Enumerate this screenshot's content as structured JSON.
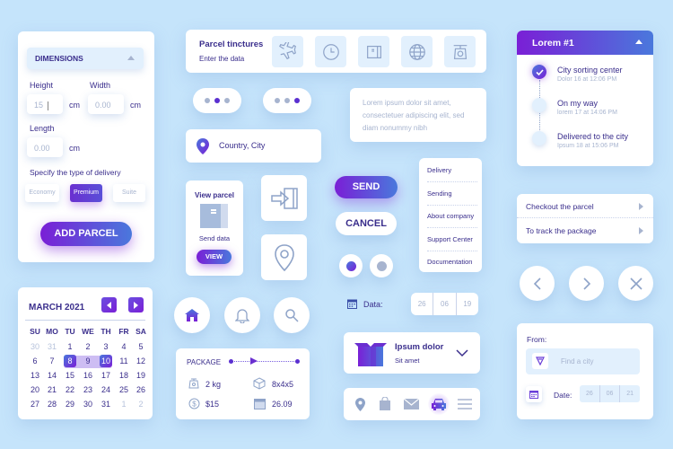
{
  "colors": {
    "background": "#c5e4fb",
    "navy": "#3a2e8c",
    "purple": "#7a1fd6",
    "blue": "#4a78dc",
    "muted": "#a7b4cf",
    "light": "#e2f0fd"
  },
  "dimensions": {
    "header": "DIMENSIONS",
    "height_label": "Height",
    "height_value": "15",
    "width_label": "Width",
    "width_placeholder": "0.00",
    "length_label": "Length",
    "length_placeholder": "0.00",
    "unit": "cm",
    "delivery_label": "Specify the type of delivery",
    "delivery_options": [
      "Economy",
      "Premium",
      "Suite"
    ],
    "delivery_selected": "Premium",
    "add_button": "ADD PARCEL"
  },
  "calendar": {
    "title": "MARCH 2021",
    "weekdays": [
      "SU",
      "MO",
      "TU",
      "WE",
      "TH",
      "FR",
      "SA"
    ],
    "weeks": [
      [
        "30",
        "31",
        "1",
        "2",
        "3",
        "4",
        "5"
      ],
      [
        "6",
        "7",
        "8",
        "9",
        "10",
        "11",
        "12"
      ],
      [
        "13",
        "14",
        "15",
        "16",
        "17",
        "18",
        "19"
      ],
      [
        "20",
        "21",
        "22",
        "23",
        "24",
        "25",
        "26"
      ],
      [
        "27",
        "28",
        "29",
        "30",
        "31",
        "1",
        "2"
      ]
    ],
    "range_start": "8",
    "range_end": "10"
  },
  "parcel_tinctures": {
    "title": "Parcel tinctures",
    "subtitle": "Enter the data",
    "icons": [
      "airplane-icon",
      "clock-icon",
      "box-icon",
      "globe-icon",
      "scale-icon"
    ]
  },
  "location": {
    "text": "Country, City"
  },
  "lorem_text": "Lorem ipsum dolor sit amet, consectetuer adipiscing elit, sed diam nonummy nibh",
  "view_parcel": {
    "title": "View parcel",
    "subtitle": "Send data",
    "button": "VIEW"
  },
  "buttons": {
    "send": "SEND",
    "cancel": "CANCEL"
  },
  "menu": {
    "items": [
      "Delivery",
      "Sending",
      "About company",
      "Support Center",
      "Documentation"
    ]
  },
  "tracking": {
    "title": "Lorem #1",
    "steps": [
      {
        "title": "City sorting center",
        "time": "Dolor 16 at 12:06 PM",
        "done": true
      },
      {
        "title": "On my way",
        "time": "lorem 17 at 14:06 PM",
        "done": false
      },
      {
        "title": "Delivered to the city",
        "time": "Ipsum 18 at 15:06 PM",
        "done": false
      }
    ]
  },
  "links": {
    "items": [
      "Checkout the parcel",
      "To track the package"
    ]
  },
  "package": {
    "title": "PACKAGE",
    "weight": "2 kg",
    "size": "8x4x5",
    "price": "$15",
    "date": "26.09"
  },
  "data_row": {
    "label": "Data:",
    "day": "26",
    "month": "06",
    "year": "19"
  },
  "dropdown": {
    "title": "Ipsum dolor",
    "subtitle": "Sit amet"
  },
  "from_card": {
    "label": "From:",
    "placeholder": "Find a city",
    "date_label": "Date:",
    "day": "26",
    "month": "06",
    "year": "21"
  }
}
